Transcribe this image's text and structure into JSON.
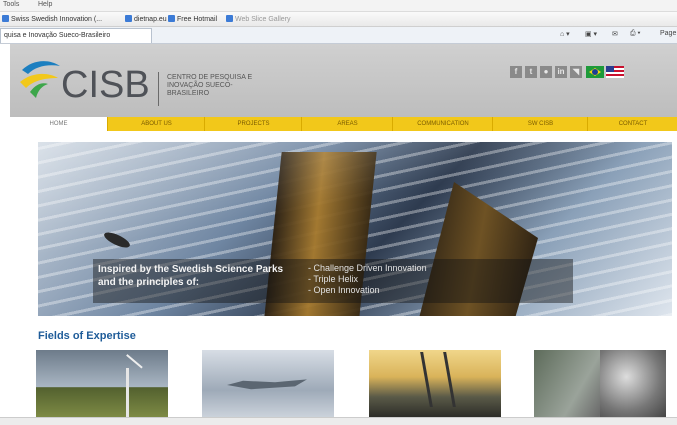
{
  "browser": {
    "menu": [
      "Tools",
      "Help"
    ],
    "favorites": [
      {
        "label": "Swiss Swedish Innovation (..."
      },
      {
        "label": "dietnap.eu"
      },
      {
        "label": "Free Hotmail"
      },
      {
        "label": "Web Slice Gallery"
      }
    ],
    "tab_title": "quisa e Inovação Sueco-Brasileiro",
    "command_page": "Page"
  },
  "site": {
    "logo_text": "CISB",
    "logo_subtitle": "CENTRO DE PESQUISA E INOVAÇÃO SUECO-BRASILEIRO",
    "social_icons": [
      "facebook-icon",
      "twitter-icon",
      "flickr-icon",
      "linkedin-icon",
      "rss-icon"
    ],
    "nav": [
      "HOME",
      "ABOUT US",
      "PROJECTS",
      "AREAS",
      "COMMUNICATION",
      "SW CISB",
      "CONTACT"
    ],
    "hero": {
      "title": "Inspired by the Swedish Science Parks and the principles of:",
      "bullets": [
        "- Challenge Driven Innovation",
        "- Triple Helix",
        "- Open Innovation"
      ]
    },
    "fields_title": "Fields of Expertise",
    "fields": [
      "wind-turbine",
      "fighter-jet",
      "cable-stayed-bridge",
      "research-facility"
    ]
  },
  "colors": {
    "nav_yellow": "#f2c81a",
    "header_gray": "#c6c6c6",
    "fields_title_blue": "#1f5c99"
  }
}
